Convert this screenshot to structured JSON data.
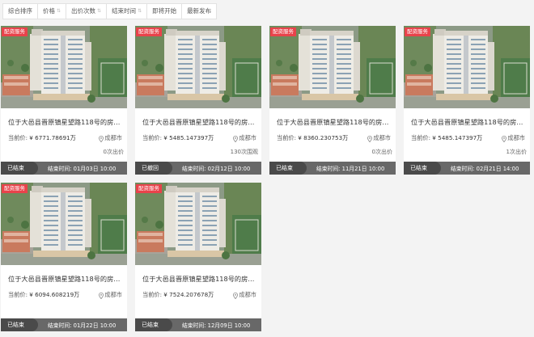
{
  "sort": [
    {
      "label": "综合排序",
      "arrow": false
    },
    {
      "label": "价格",
      "arrow": true
    },
    {
      "label": "出价次数",
      "arrow": true
    },
    {
      "label": "结束时间",
      "arrow": true
    },
    {
      "label": "即将开始",
      "arrow": false
    },
    {
      "label": "最新发布",
      "arrow": false
    }
  ],
  "arrow_glyph": "⇅",
  "cards": [
    {
      "tag": "配资服务",
      "title": "位于大邑县晋原镇星望路118号的房屋、...",
      "price_label": "当前价:",
      "price": "¥ 6771.78691万",
      "location": "成都市",
      "bids": "0次出价",
      "status": "已结束",
      "end_time": "结束时间: 01月03日 10:00"
    },
    {
      "tag": "配资服务",
      "title": "位于大邑县晋原镇星望路118号的房屋、...",
      "price_label": "当前价:",
      "price": "¥ 5485.147397万",
      "location": "成都市",
      "bids": "130次围观",
      "status": "已撤回",
      "end_time": "结束时间: 02月12日 10:00"
    },
    {
      "tag": "配资服务",
      "title": "位于大邑县晋原镇星望路118号的房屋、...",
      "price_label": "当前价:",
      "price": "¥ 8360.230753万",
      "location": "成都市",
      "bids": "0次出价",
      "status": "已结束",
      "end_time": "结束时间: 11月21日 10:00"
    },
    {
      "tag": "配资服务",
      "title": "位于大邑县晋原镇星望路118号的房屋、...",
      "price_label": "当前价:",
      "price": "¥ 5485.147397万",
      "location": "成都市",
      "bids": "1次出价",
      "status": "已结束",
      "end_time": "结束时间: 02月21日 14:00"
    },
    {
      "tag": "配资服务",
      "title": "位于大邑县晋原镇星望路118号的房屋、...",
      "price_label": "当前价:",
      "price": "¥ 6094.608219万",
      "location": "成都市",
      "bids": "",
      "status": "已结束",
      "end_time": "结束时间: 01月22日 10:00"
    },
    {
      "tag": "配资服务",
      "title": "位于大邑县晋原镇星望路118号的房屋、...",
      "price_label": "当前价:",
      "price": "¥ 7524.207678万",
      "location": "成都市",
      "bids": "",
      "status": "已结束",
      "end_time": "结束时间: 12月09日 10:00"
    }
  ]
}
